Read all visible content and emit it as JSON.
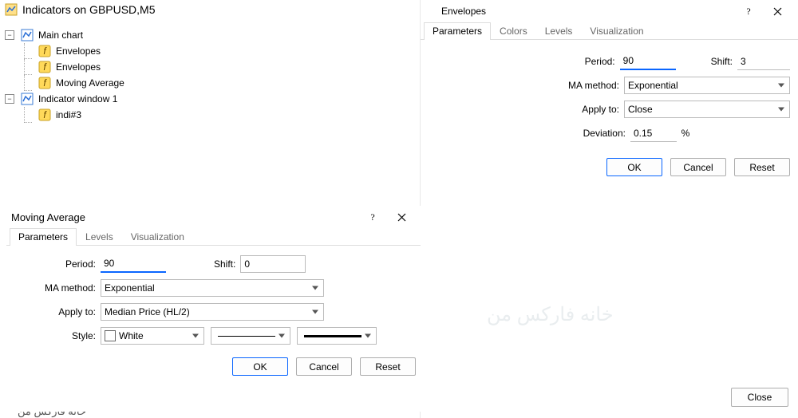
{
  "main": {
    "title": "Indicators on GBPUSD,M5",
    "tree": {
      "node1": {
        "label": "Main chart"
      },
      "node1_children": [
        {
          "label": "Envelopes"
        },
        {
          "label": "Envelopes"
        },
        {
          "label": "Moving Average"
        }
      ],
      "node2": {
        "label": "Indicator window 1"
      },
      "node2_children": [
        {
          "label": "indi#3"
        }
      ]
    }
  },
  "env": {
    "title": "Envelopes",
    "tabs": [
      "Parameters",
      "Colors",
      "Levels",
      "Visualization"
    ],
    "labels": {
      "period": "Period:",
      "shift": "Shift:",
      "ma": "MA method:",
      "apply": "Apply to:",
      "dev": "Deviation:",
      "dev_unit": "%"
    },
    "values": {
      "period": "90",
      "shift": "3",
      "ma": "Exponential",
      "apply": "Close",
      "dev": "0.15"
    },
    "buttons": {
      "ok": "OK",
      "cancel": "Cancel",
      "reset": "Reset"
    }
  },
  "ma": {
    "title": "Moving Average",
    "tabs": [
      "Parameters",
      "Levels",
      "Visualization"
    ],
    "labels": {
      "period": "Period:",
      "shift": "Shift:",
      "ma": "MA method:",
      "apply": "Apply to:",
      "style": "Style:"
    },
    "values": {
      "period": "90",
      "shift": "0",
      "ma": "Exponential",
      "apply": "Median Price (HL/2)",
      "color": "White"
    },
    "buttons": {
      "ok": "OK",
      "cancel": "Cancel",
      "reset": "Reset"
    }
  },
  "global": {
    "close": "Close",
    "watermark": "خانه فارکس من"
  }
}
